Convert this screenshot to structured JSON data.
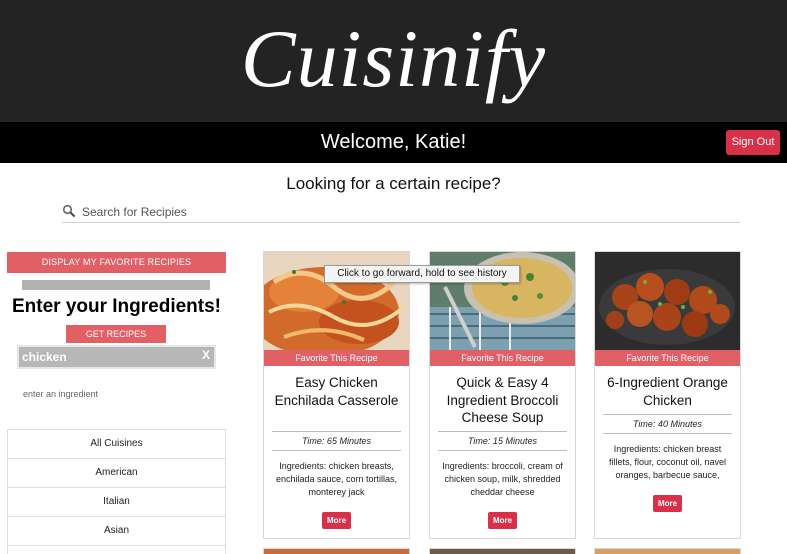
{
  "app": {
    "logo": "Cuisinify",
    "welcome": "Welcome, Katie!",
    "sign_out": "Sign Out"
  },
  "search": {
    "question": "Looking for a certain recipe?",
    "placeholder": "Search for Recipies",
    "value": ""
  },
  "sidebar": {
    "favorites_button": "DISPLAY MY FAVORITE RECIPIES",
    "heading": "Enter your Ingredients!",
    "get_button": "GET RECIPES",
    "chip": {
      "label": "chicken",
      "remove": "X"
    },
    "ingredient_hint": "enter an ingredient",
    "cuisines": [
      "All Cuisines",
      "American",
      "Italian",
      "Asian"
    ]
  },
  "tooltip": "Click to go forward, hold to see history",
  "recipes": [
    {
      "favorite_label": "Favorite This Recipe",
      "title": "Easy Chicken Enchilada Casserole",
      "time": "Time: 65 Minutes",
      "ingredients": "Ingredients: chicken breasts, enchilada sauce, corn tortillas, monterey jack",
      "more": "More"
    },
    {
      "favorite_label": "Favorite This Recipe",
      "title": "Quick & Easy 4 Ingredient Broccoli Cheese Soup",
      "time": "Time: 15 Minutes",
      "ingredients": "Ingredients: broccoli, cream of chicken soup, milk, shredded cheddar cheese",
      "more": "More"
    },
    {
      "favorite_label": "Favorite This Recipe",
      "title": "6-Ingredient Orange Chicken",
      "time": "Time: 40 Minutes",
      "ingredients": "Ingredients: chicken breast fillets, flour, coconut oil, navel oranges, barbecue sauce,",
      "more": "More"
    }
  ],
  "colors": {
    "banner": "#232323",
    "accent": "#e06066",
    "button_red": "#d9304a"
  }
}
